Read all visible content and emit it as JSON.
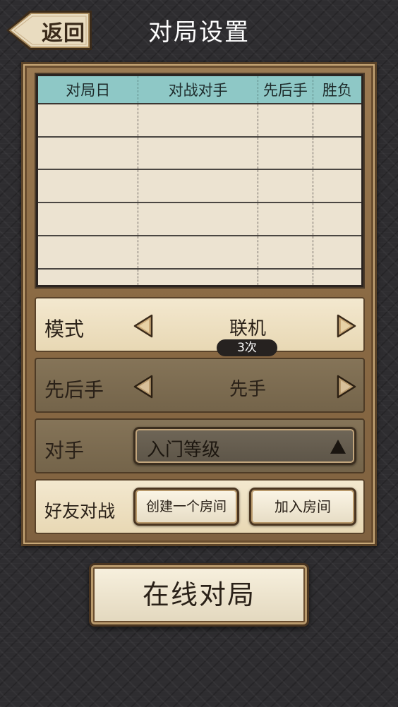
{
  "header": {
    "back_label": "返回",
    "title": "对局设置"
  },
  "history_table": {
    "columns": [
      "对局日",
      "对战对手",
      "先后手",
      "胜负"
    ],
    "rows": [
      [
        "",
        "",
        "",
        ""
      ],
      [
        "",
        "",
        "",
        ""
      ],
      [
        "",
        "",
        "",
        ""
      ],
      [
        "",
        "",
        "",
        ""
      ],
      [
        "",
        "",
        "",
        ""
      ],
      [
        "",
        "",
        "",
        ""
      ]
    ]
  },
  "mode": {
    "label": "模式",
    "value": "联机",
    "badge": "3次"
  },
  "turn_order": {
    "label": "先后手",
    "value": "先手"
  },
  "opponent": {
    "label": "对手",
    "value": "入门等级"
  },
  "friend_battle": {
    "label": "好友对战",
    "create_room": "创建一个房间",
    "join_room": "加入房间"
  },
  "online_button": {
    "label": "在线对局"
  },
  "colors": {
    "table_header": "#8ec8c6",
    "panel_wood": "#8a6a44",
    "cream": "#ece3d1"
  }
}
